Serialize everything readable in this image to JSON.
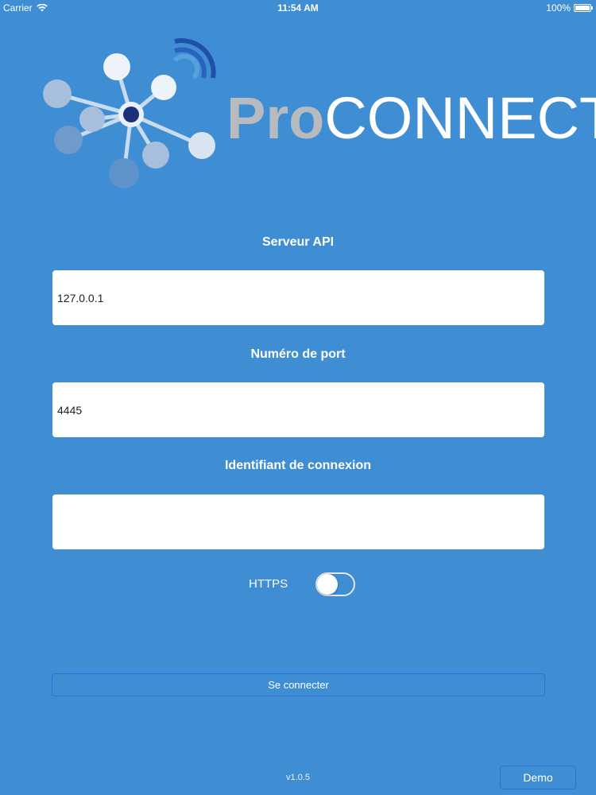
{
  "status_bar": {
    "carrier": "Carrier",
    "time": "11:54 AM",
    "battery": "100%",
    "wifi_icon": "wifi-icon",
    "battery_icon": "battery-icon"
  },
  "logo": {
    "pro": "Pro",
    "connect": "CONNECT",
    "icon": "network-node-icon"
  },
  "form": {
    "server_label": "Serveur API",
    "server_value": "127.0.0.1",
    "port_label": "Numéro de port",
    "port_value": "4445",
    "login_label": "Identifiant de connexion",
    "login_value": "",
    "https_label": "HTTPS",
    "https_enabled": false
  },
  "actions": {
    "connect_label": "Se connecter",
    "demo_label": "Demo"
  },
  "footer": {
    "version": "v1.0.5"
  },
  "colors": {
    "background": "#3f8ed3",
    "button_border": "#2f6fd6",
    "logo_pro": "#b7bbbf"
  }
}
